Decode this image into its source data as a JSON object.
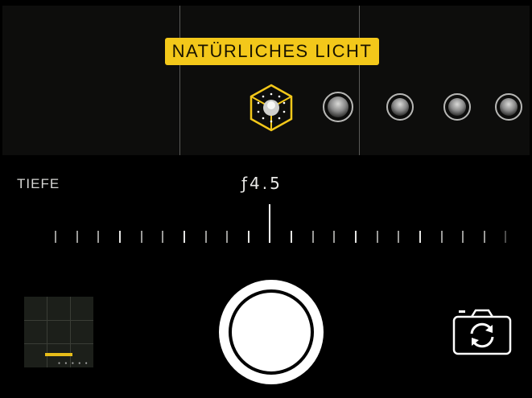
{
  "viewfinder": {
    "lighting_label": "NATÜRLICHES LICHT",
    "lighting_options": [
      {
        "name": "natural-light-icon",
        "selected": true
      },
      {
        "name": "studio-light-icon",
        "selected": false
      },
      {
        "name": "contour-light-icon",
        "selected": false
      },
      {
        "name": "stage-light-icon",
        "selected": false
      },
      {
        "name": "stage-light-mono-icon",
        "selected": false
      }
    ]
  },
  "depth": {
    "label": "TIEFE",
    "value": "ƒ4.5"
  },
  "colors": {
    "accent": "#f3c81a",
    "background": "#000000"
  }
}
